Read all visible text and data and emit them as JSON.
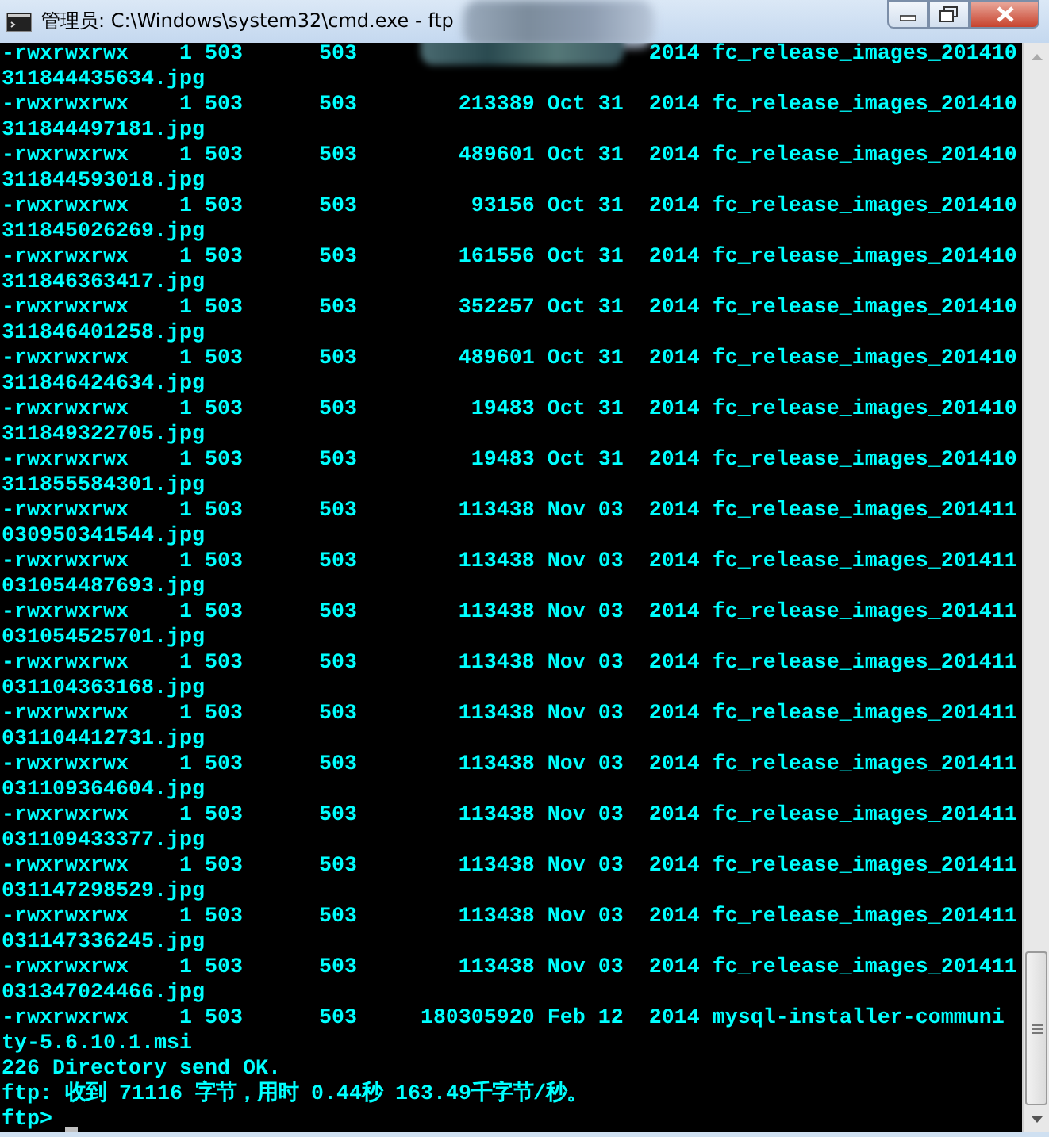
{
  "window": {
    "title": "管理员: C:\\Windows\\system32\\cmd.exe - ftp"
  },
  "console": {
    "lines": [
      {
        "kind": "redacted",
        "left": "-rwxrwxrwx    1 503      503",
        "right": "2014 fc_release_images_201410"
      },
      {
        "kind": "text",
        "text": "311844435634.jpg"
      },
      {
        "kind": "text",
        "text": "-rwxrwxrwx    1 503      503        213389 Oct 31  2014 fc_release_images_201410"
      },
      {
        "kind": "text",
        "text": "311844497181.jpg"
      },
      {
        "kind": "text",
        "text": "-rwxrwxrwx    1 503      503        489601 Oct 31  2014 fc_release_images_201410"
      },
      {
        "kind": "text",
        "text": "311844593018.jpg"
      },
      {
        "kind": "text",
        "text": "-rwxrwxrwx    1 503      503         93156 Oct 31  2014 fc_release_images_201410"
      },
      {
        "kind": "text",
        "text": "311845026269.jpg"
      },
      {
        "kind": "text",
        "text": "-rwxrwxrwx    1 503      503        161556 Oct 31  2014 fc_release_images_201410"
      },
      {
        "kind": "text",
        "text": "311846363417.jpg"
      },
      {
        "kind": "text",
        "text": "-rwxrwxrwx    1 503      503        352257 Oct 31  2014 fc_release_images_201410"
      },
      {
        "kind": "text",
        "text": "311846401258.jpg"
      },
      {
        "kind": "text",
        "text": "-rwxrwxrwx    1 503      503        489601 Oct 31  2014 fc_release_images_201410"
      },
      {
        "kind": "text",
        "text": "311846424634.jpg"
      },
      {
        "kind": "text",
        "text": "-rwxrwxrwx    1 503      503         19483 Oct 31  2014 fc_release_images_201410"
      },
      {
        "kind": "text",
        "text": "311849322705.jpg"
      },
      {
        "kind": "text",
        "text": "-rwxrwxrwx    1 503      503         19483 Oct 31  2014 fc_release_images_201410"
      },
      {
        "kind": "text",
        "text": "311855584301.jpg"
      },
      {
        "kind": "text",
        "text": "-rwxrwxrwx    1 503      503        113438 Nov 03  2014 fc_release_images_201411"
      },
      {
        "kind": "text",
        "text": "030950341544.jpg"
      },
      {
        "kind": "text",
        "text": "-rwxrwxrwx    1 503      503        113438 Nov 03  2014 fc_release_images_201411"
      },
      {
        "kind": "text",
        "text": "031054487693.jpg"
      },
      {
        "kind": "text",
        "text": "-rwxrwxrwx    1 503      503        113438 Nov 03  2014 fc_release_images_201411"
      },
      {
        "kind": "text",
        "text": "031054525701.jpg"
      },
      {
        "kind": "text",
        "text": "-rwxrwxrwx    1 503      503        113438 Nov 03  2014 fc_release_images_201411"
      },
      {
        "kind": "text",
        "text": "031104363168.jpg"
      },
      {
        "kind": "text",
        "text": "-rwxrwxrwx    1 503      503        113438 Nov 03  2014 fc_release_images_201411"
      },
      {
        "kind": "text",
        "text": "031104412731.jpg"
      },
      {
        "kind": "text",
        "text": "-rwxrwxrwx    1 503      503        113438 Nov 03  2014 fc_release_images_201411"
      },
      {
        "kind": "text",
        "text": "031109364604.jpg"
      },
      {
        "kind": "text",
        "text": "-rwxrwxrwx    1 503      503        113438 Nov 03  2014 fc_release_images_201411"
      },
      {
        "kind": "text",
        "text": "031109433377.jpg"
      },
      {
        "kind": "text",
        "text": "-rwxrwxrwx    1 503      503        113438 Nov 03  2014 fc_release_images_201411"
      },
      {
        "kind": "text",
        "text": "031147298529.jpg"
      },
      {
        "kind": "text",
        "text": "-rwxrwxrwx    1 503      503        113438 Nov 03  2014 fc_release_images_201411"
      },
      {
        "kind": "text",
        "text": "031147336245.jpg"
      },
      {
        "kind": "text",
        "text": "-rwxrwxrwx    1 503      503        113438 Nov 03  2014 fc_release_images_201411"
      },
      {
        "kind": "text",
        "text": "031347024466.jpg"
      },
      {
        "kind": "text",
        "text": "-rwxrwxrwx    1 503      503     180305920 Feb 12  2014 mysql-installer-communi"
      },
      {
        "kind": "text",
        "text": "ty-5.6.10.1.msi"
      },
      {
        "kind": "text",
        "text": "226 Directory send OK."
      },
      {
        "kind": "text",
        "text": "ftp: 收到 71116 字节，用时 0.44秒 163.49千字节/秒。"
      },
      {
        "kind": "prompt",
        "text": "ftp>"
      }
    ]
  }
}
